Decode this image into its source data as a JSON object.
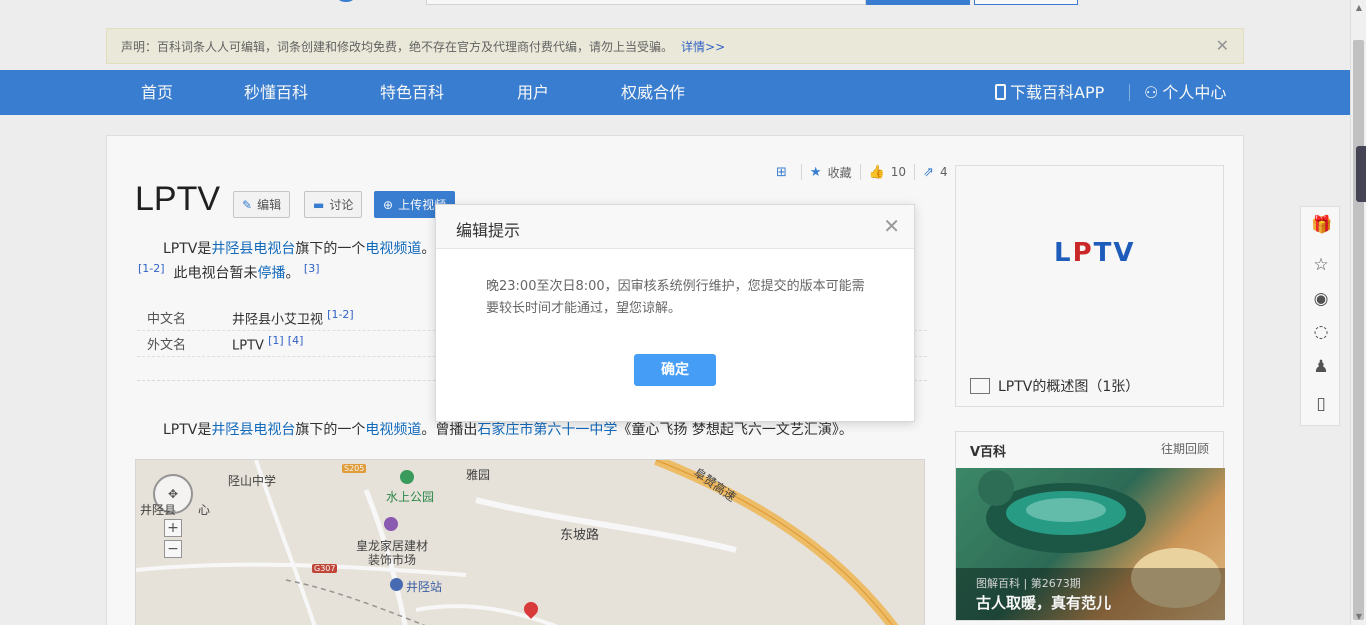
{
  "notice": {
    "text": "声明：百科词条人人可编辑，词条创建和修改均免费，绝不存在官方及代理商付费代编，请勿上当受骗。",
    "link": "详情>>",
    "close": "✕"
  },
  "nav": {
    "items": [
      "首页",
      "秒懂百科",
      "特色百科",
      "用户",
      "权威合作"
    ],
    "app": "下载百科APP",
    "user": "个人中心"
  },
  "entry": {
    "title": "LPTV",
    "edit_btn": "编辑",
    "discuss_btn": "讨论",
    "upload_btn": "上传视频",
    "actions": {
      "collect": "收藏",
      "likes": "10",
      "shares": "4"
    },
    "summary": {
      "p1": "LPTV是",
      "l1": "井陉县电视台",
      "p2": "旗下的一个",
      "l2": "电视频道",
      "p3": "。",
      "r1": "[1-2]",
      "p4": "此电视台暂未",
      "l3": "停播",
      "p5": "。",
      "r2": "[3]"
    },
    "basic": [
      {
        "key": "中文名",
        "value": "井陉县小艾卫视",
        "ref": "[1-2]"
      },
      {
        "key": "外文名",
        "value": "LPTV",
        "ref": "[1]",
        "ref2": "[4]"
      }
    ],
    "body": {
      "p1": "LPTV是",
      "l1": "井陉县电视台",
      "p2": "旗下的一个",
      "l2": "电视频道",
      "p3": "。曾播出",
      "l3": "石家庄市第六十一中学",
      "p4": "《童心飞扬 梦想起飞六一文艺汇演》。"
    }
  },
  "map": {
    "labels": {
      "school": "陉山中学",
      "center": "井陉县",
      "center2": "心",
      "park": "水上公园",
      "yayuan": "雅园",
      "market1": "皇龙家居建材",
      "market2": "装饰市场",
      "station": "井陉站",
      "road": "东坡路",
      "highway": "阜赞高速",
      "s205": "S205",
      "g307": "G307"
    },
    "zoom_in": "+",
    "zoom_out": "−"
  },
  "sidebar": {
    "logo_main": "L",
    "logo_red": "P",
    "logo_tail": "TV",
    "caption": "LPTV的概述图（1张）",
    "vbaike": {
      "title": "V百科",
      "more": "往期回顾",
      "tag": "图解百科 | 第2673期",
      "slogan": "古人取暖，真有范儿"
    }
  },
  "modal": {
    "title": "编辑提示",
    "close": "✕",
    "body": "晚23:00至次日8:00，因审核系统例行维护，您提交的版本可能需要较长时间才能通过，望您谅解。",
    "ok": "确定"
  },
  "colors": {
    "brand": "#3a82d6",
    "link": "#136ec2",
    "button": "#459df5"
  }
}
